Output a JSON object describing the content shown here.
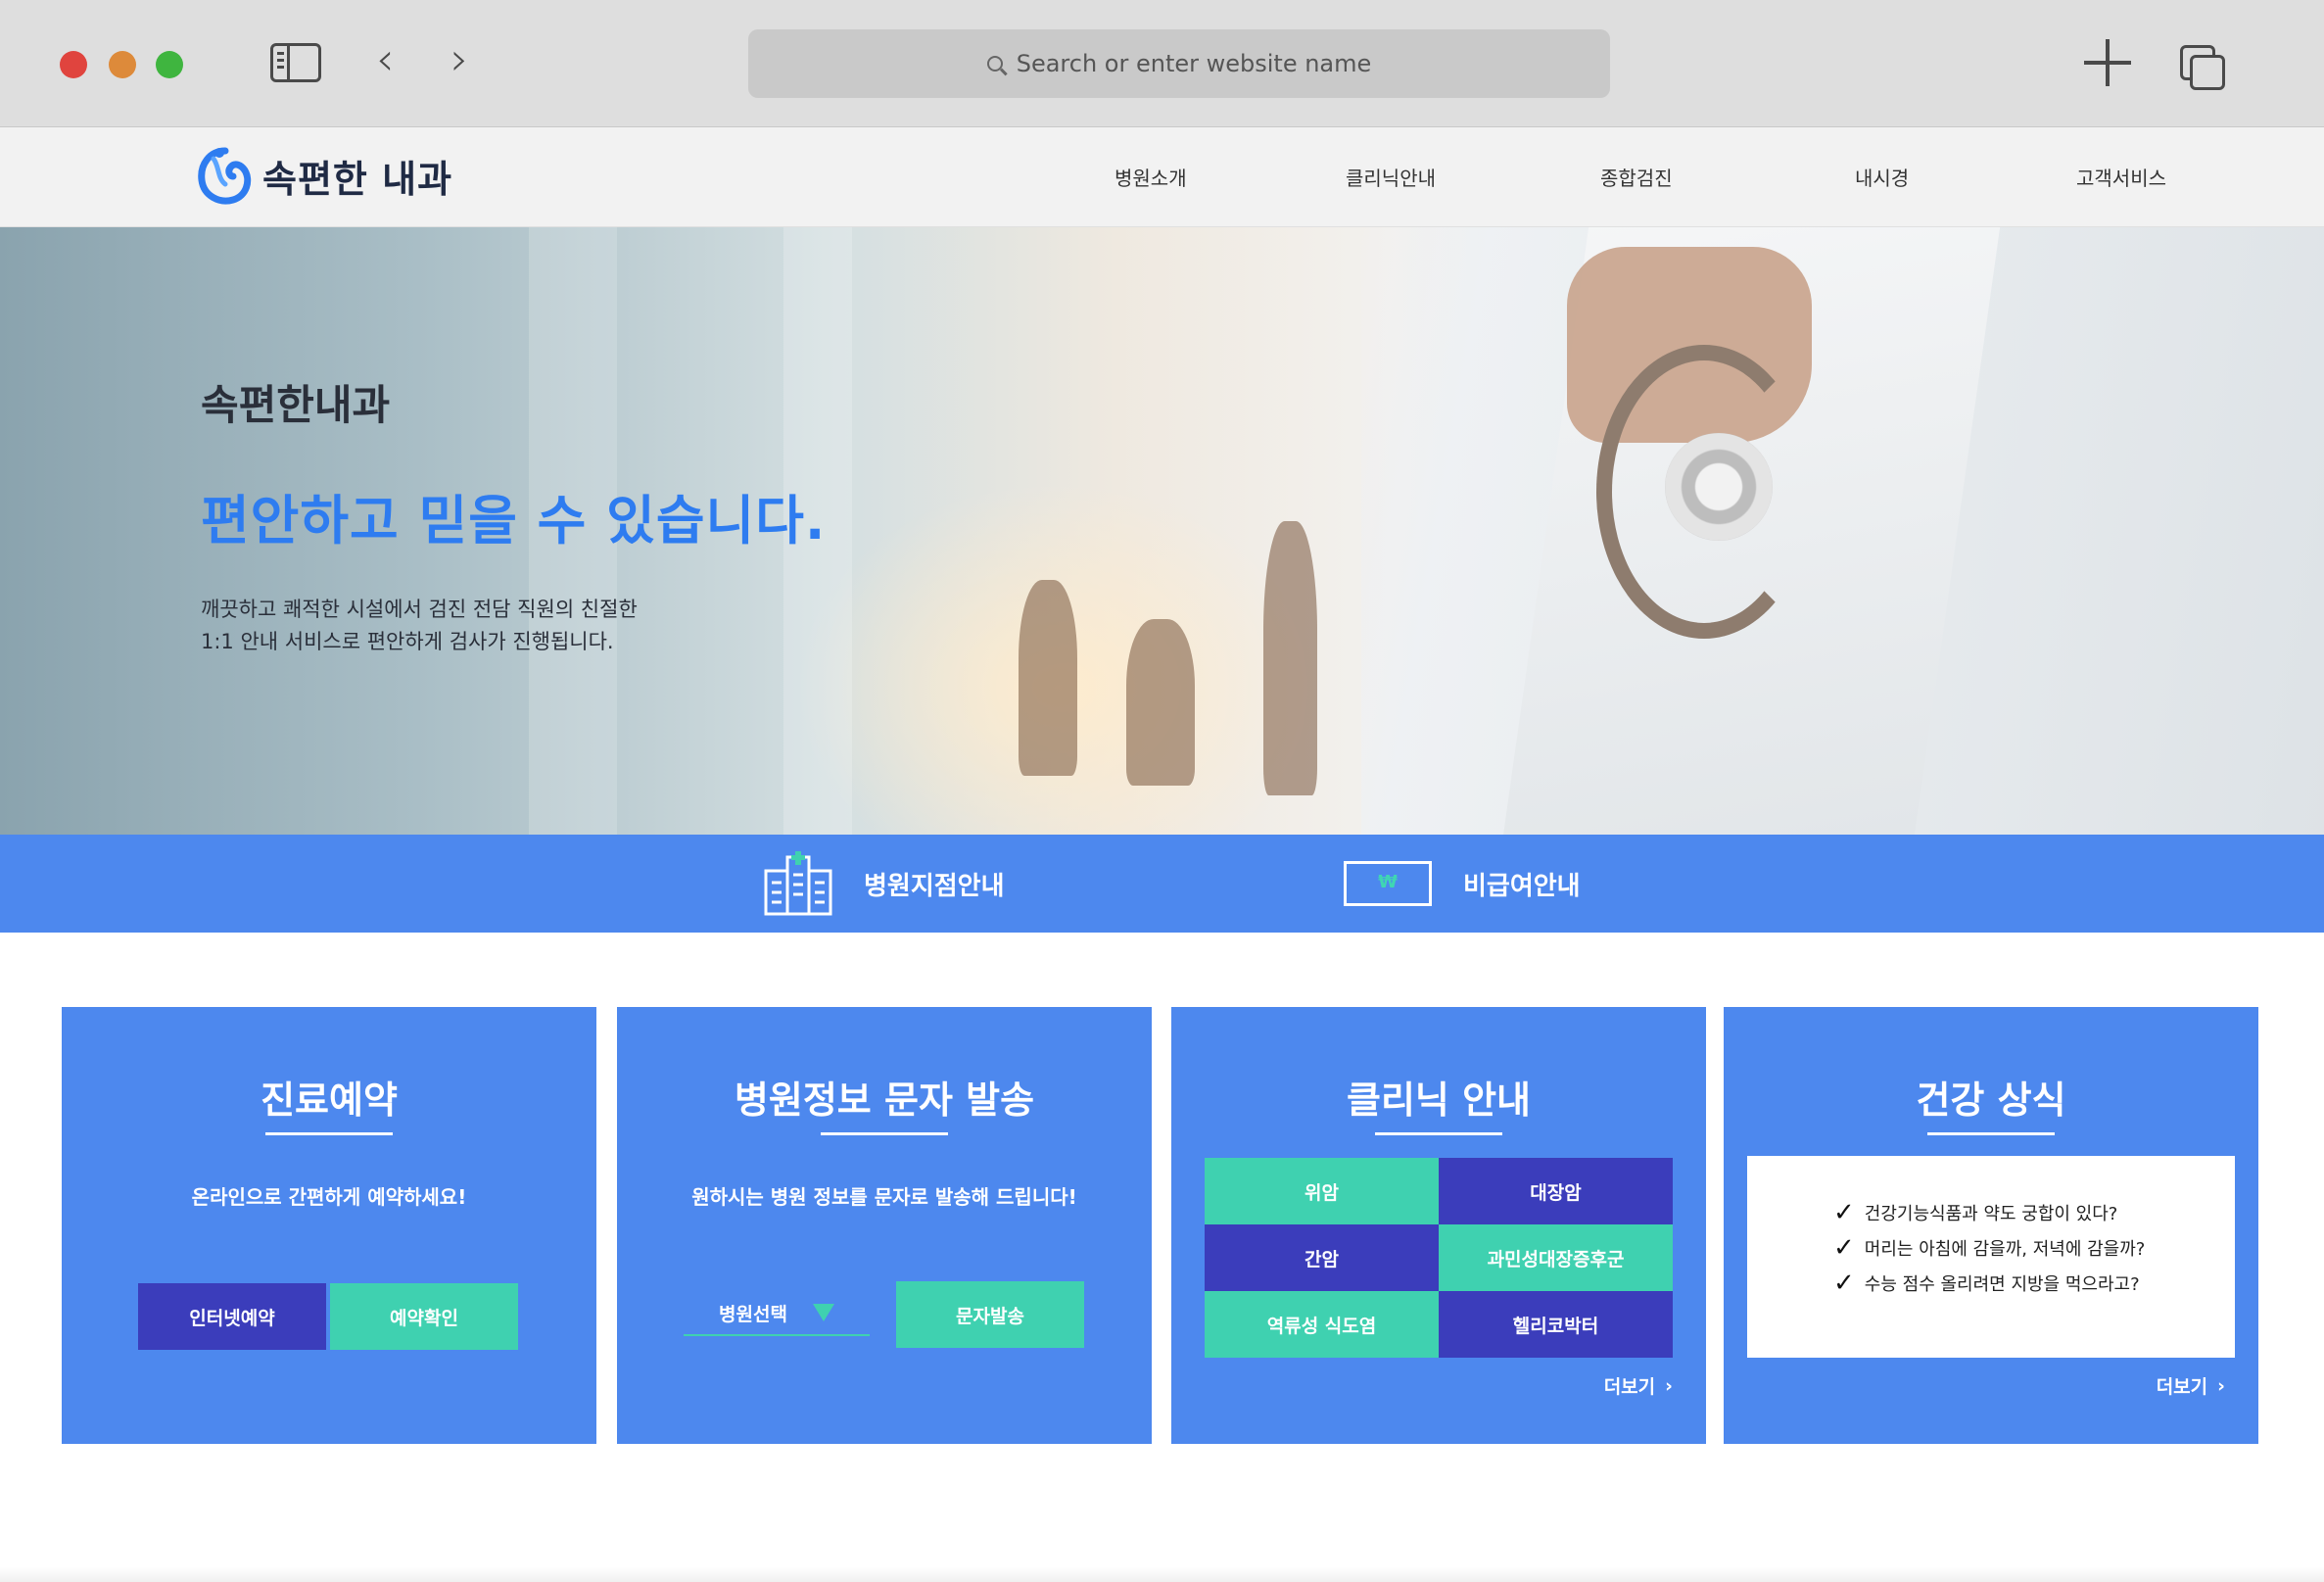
{
  "browser": {
    "address_placeholder": "Search or enter website name"
  },
  "site": {
    "logo_text": "속편한 내과",
    "nav": [
      "병원소개",
      "클리닉안내",
      "종합검진",
      "내시경",
      "고객서비스"
    ]
  },
  "hero": {
    "subtitle": "속편한내과",
    "title": "편안하고 믿을 수 있습니다.",
    "desc_line1": "깨끗하고 쾌적한 시설에서 검진 전담 직원의 친절한",
    "desc_line2": "1:1 안내 서비스로 편안하게 검사가 진행됩니다."
  },
  "quick_bar": {
    "branch_label": "병원지점안내",
    "fee_label": "비급여안내",
    "fee_icon_symbol": "₩"
  },
  "cards": {
    "reservation": {
      "title": "진료예약",
      "subtitle": "온라인으로 간편하게 예약하세요!",
      "btn_online": "인터넷예약",
      "btn_check": "예약확인"
    },
    "sms": {
      "title": "병원정보 문자 발송",
      "subtitle": "원하시는 병원 정보를 문자로 발송해 드립니다!",
      "select_label": "병원선택",
      "btn_send": "문자발송"
    },
    "clinic": {
      "title": "클리닉 안내",
      "items": [
        "위암",
        "대장암",
        "간암",
        "과민성대장증후군",
        "역류성 식도염",
        "헬리코박터"
      ],
      "more": "더보기"
    },
    "health": {
      "title": "건강 상식",
      "tips": [
        "건강기능식품과 약도 궁합이 있다?",
        "머리는 아침에 감을까, 저녁에 감을까?",
        "수능 점수 올리려면 지방을 먹으라고?"
      ],
      "more": "더보기"
    }
  },
  "colors": {
    "primary_blue": "#4d88ee",
    "dark_indigo": "#3b3dbb",
    "teal": "#3fd1b0",
    "hero_title": "#2e7cf0"
  }
}
